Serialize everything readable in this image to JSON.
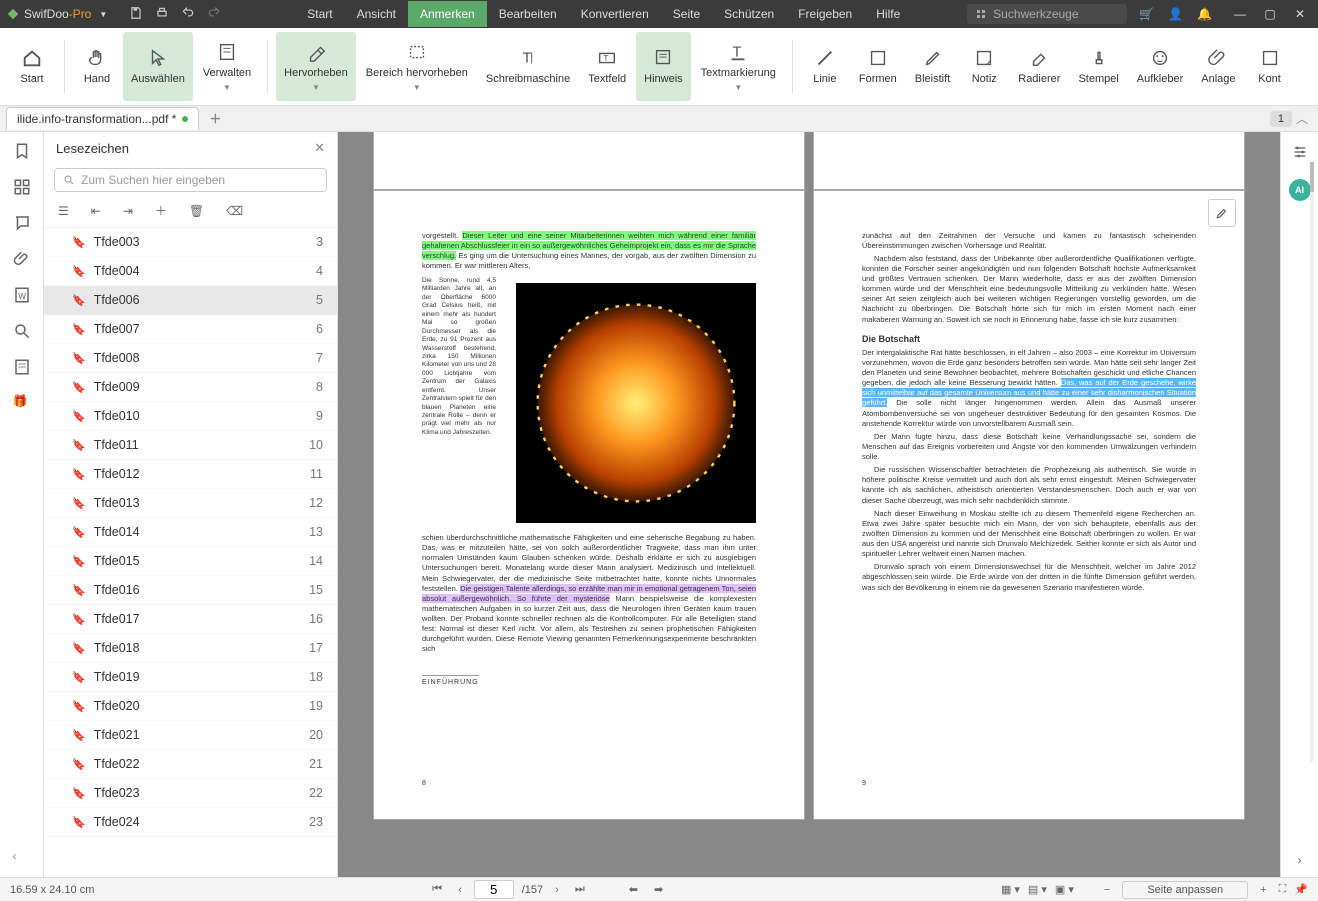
{
  "app": {
    "name": "SwifDoo",
    "suffix": "-Pro"
  },
  "menus": [
    "Start",
    "Ansicht",
    "Anmerken",
    "Bearbeiten",
    "Konvertieren",
    "Seite",
    "Schützen",
    "Freigeben",
    "Hilfe"
  ],
  "active_menu": 2,
  "search_tools_placeholder": "Suchwerkzeuge",
  "ribbon": [
    {
      "label": "Start"
    },
    {
      "label": "Hand"
    },
    {
      "label": "Auswählen",
      "active": true
    },
    {
      "label": "Verwalten",
      "caret": true
    },
    {
      "label": "Hervorheben",
      "active": true,
      "caret": true
    },
    {
      "label": "Bereich hervorheben",
      "caret": true
    },
    {
      "label": "Schreibmaschine"
    },
    {
      "label": "Textfeld"
    },
    {
      "label": "Hinweis",
      "active": true
    },
    {
      "label": "Textmarkierung",
      "caret": true
    },
    {
      "label": "Linie"
    },
    {
      "label": "Formen"
    },
    {
      "label": "Bleistift"
    },
    {
      "label": "Notiz"
    },
    {
      "label": "Radierer"
    },
    {
      "label": "Stempel"
    },
    {
      "label": "Aufkleber"
    },
    {
      "label": "Anlage"
    },
    {
      "label": "Kont"
    }
  ],
  "tab": {
    "title": "ilide.info-transformation...pdf *"
  },
  "tab_page_badge": "1",
  "panel": {
    "title": "Lesezeichen",
    "search_placeholder": "Zum Suchen hier eingeben",
    "items": [
      {
        "label": "Tfde003",
        "page": "3"
      },
      {
        "label": "Tfde004",
        "page": "4"
      },
      {
        "label": "Tfde006",
        "page": "5",
        "selected": true
      },
      {
        "label": "Tfde007",
        "page": "6"
      },
      {
        "label": "Tfde008",
        "page": "7"
      },
      {
        "label": "Tfde009",
        "page": "8"
      },
      {
        "label": "Tfde010",
        "page": "9"
      },
      {
        "label": "Tfde011",
        "page": "10"
      },
      {
        "label": "Tfde012",
        "page": "11"
      },
      {
        "label": "Tfde013",
        "page": "12"
      },
      {
        "label": "Tfde014",
        "page": "13"
      },
      {
        "label": "Tfde015",
        "page": "14"
      },
      {
        "label": "Tfde016",
        "page": "15"
      },
      {
        "label": "Tfde017",
        "page": "16"
      },
      {
        "label": "Tfde018",
        "page": "17"
      },
      {
        "label": "Tfde019",
        "page": "18"
      },
      {
        "label": "Tfde020",
        "page": "19"
      },
      {
        "label": "Tfde021",
        "page": "20"
      },
      {
        "label": "Tfde022",
        "page": "21"
      },
      {
        "label": "Tfde023",
        "page": "22"
      },
      {
        "label": "Tfde024",
        "page": "23"
      }
    ]
  },
  "doc": {
    "left": {
      "intro": "vorgestellt. ",
      "hlG": "Dieser Leiter und eine seiner Mitarbeiterinnen weihten mich während einer familiär gehaltenen Abschlussfeier in ein so außergewöhnliches Geheimprojekt ein, dass es mir die Sprache verschlug.",
      "after_hlG": " Es ging um die Untersuchung eines Mannes, der vorgab, aus der zwölften Dimension zu kommen. Er war mittleren Alters,",
      "sidecol": "Die Sonne, rund 4,5 Milliarden Jahre alt, an der Oberfläche 6000 Grad Celsius heiß, mit einem mehr als hundert Mal so großen Durchmesser als die Erde, zu 91 Prozent aus Wasserstoff bestehend, zirka 150 Millionen Kilometer von uns und 28 000 Lichtjahre vom Zentrum der Galaxis entfernt. Unser Zentralstern spielt für den blauen Planeten eine zentrale Rolle – denn er prägt viel mehr als nur Klima und Jahreszeiten.",
      "body2": "schien überdurchschnittliche mathematische Fähigkeiten und eine seherische Begabung zu haben. Das, was er mitzuteilen hätte, sei von solch außerordentlicher Tragweite, dass man ihm unter normalen Umständen kaum Glauben schenken würde. Deshalb erklärte er sich zu ausgiebigen Untersuchungen bereit. Monatelang wurde dieser Mann analysiert. Medizinisch und intellektuell. Mein Schwiegervater, der die medizinische Seite mitbetrachtet hatte, konnte nichts Unnormales feststellen. ",
      "hlP": "Die geistigen Talente allerdings, so erzählte man mir in emotional getragenem Ton, seien absolut außergewöhnlich. So führte der mysteriöse",
      "after_hlP": " Mann beispielsweise die komplexesten mathematischen Aufgaben in so kurzer Zeit aus, dass die Neurologen ihren Geräten kaum trauen wollten. Der Proband konnte schneller rechnen als die Kontrollcomputer. Für alle Beteiligten stand fest: Normal ist dieser Kerl nicht. Vor allem, als Testreihen zu seinen prophetischen Fähigkeiten durchgeführt wurden. Diese Remote Viewing genannten Fernerkennungsexperimente beschränkten sich",
      "footer": "EINFÜHRUNG",
      "page_no": "8"
    },
    "right": {
      "p1": "zunächst auf den Zeitrahmen der Versuche und kamen zu fantastisch scheinenden Übereinstimmungen zwischen Vorhersage und Realität.",
      "p2": "Nachdem also feststand, dass der Unbekannte über außerordentliche Qualifikationen verfügte, konnten die Forscher seiner angekündigten und nun folgenden Botschaft höchste Aufmerksamkeit und größtes Vertrauen schenken. Der Mann wiederholte, dass er aus der zwölften Dimension kommen würde und der Menschheit eine bedeutungsvolle Mitteilung zu verkünden hätte. Wesen seiner Art seien zeitgleich auch bei weiteren wichtigen Regierungen vorstellig geworden, um die Nachricht zu überbringen. Die Botschaft hörte sich für mich im ersten Moment nach einer makaberen Warnung an. Soweit ich sie noch in Erinnerung habe, fasse ich sie kurz zusammen:",
      "heading": "Die Botschaft",
      "p3a": "Der intergalaktische Rat hätte beschlossen, in elf Jahren – also 2003 – eine Korrektur im Universum vorzunehmen, wovon die Erde ganz besonders betroffen sein würde. Man hätte seit sehr langer Zeit den Planeten und seine Bewohner beobachtet, mehrere Botschaften geschickt und etliche Chancen gegeben, die jedoch alle keine Besserung bewirkt hätten. ",
      "hlB": "Das, was auf der Erde geschehe, wirke sich unmittelbar auf das gesamte Universum aus und hätte zu einer sehr disharmonischen Situation geführt.",
      "p3b": " Die solle nicht länger hingenommen werden. Allein das Ausmaß unserer Atombombenversuche sei von ungeheuer destruktiver Bedeutung für den gesamten Kosmos. Die anstehende Korrektur würde von unvorstellbarem Ausmaß sein.",
      "p4": "Der Mann fügte hinzu, dass diese Botschaft keine Verhandlungssache sei, sondern die Menschen auf das Ereignis vorbereiten und Ängste vor den kommenden Umwälzungen verhindern solle.",
      "p5": "Die russischen Wissenschaftler betrachteten die Prophezeiung als authentisch. Sie wurde in höhere politische Kreise vermittelt und auch dort als sehr ernst eingestuft. Meinen Schwiegervater kannte ich als sachlichen, atheistisch orientierten Verstandesmenschen. Doch auch er war von dieser Sache überzeugt, was mich sehr nachdenklich stimmte.",
      "p6": "Nach dieser Einweihung in Moskau stellte ich zu diesem Themenfeld eigene Recherchen an. Etwa zwei Jahre später besuchte mich ein Mann, der von sich behauptete, ebenfalls aus der zwölften Dimension zu kommen und der Menschheit eine Botschaft überbringen zu wollen. Er war aus den USA angereist und nannte sich Drunvalo Melchizedek. Seither konnte er sich als Autor und spiritueller Lehrer weltweit einen Namen machen.",
      "p7": "Drunvalo sprach von einem Dimensionswechsel für die Menschheit, welcher im Jahre 2012 abgeschlossen sein würde. Die Erde würde von der dritten in die fünfte Dimension geführt werden, was sich der Bevölkerung in einem nie da gewesenen Szenario manifestieren würde.",
      "page_no": "9"
    }
  },
  "status": {
    "dims": "16.59 x 24.10 cm",
    "page": "5",
    "total": "/157",
    "fit": "Seite anpassen"
  }
}
